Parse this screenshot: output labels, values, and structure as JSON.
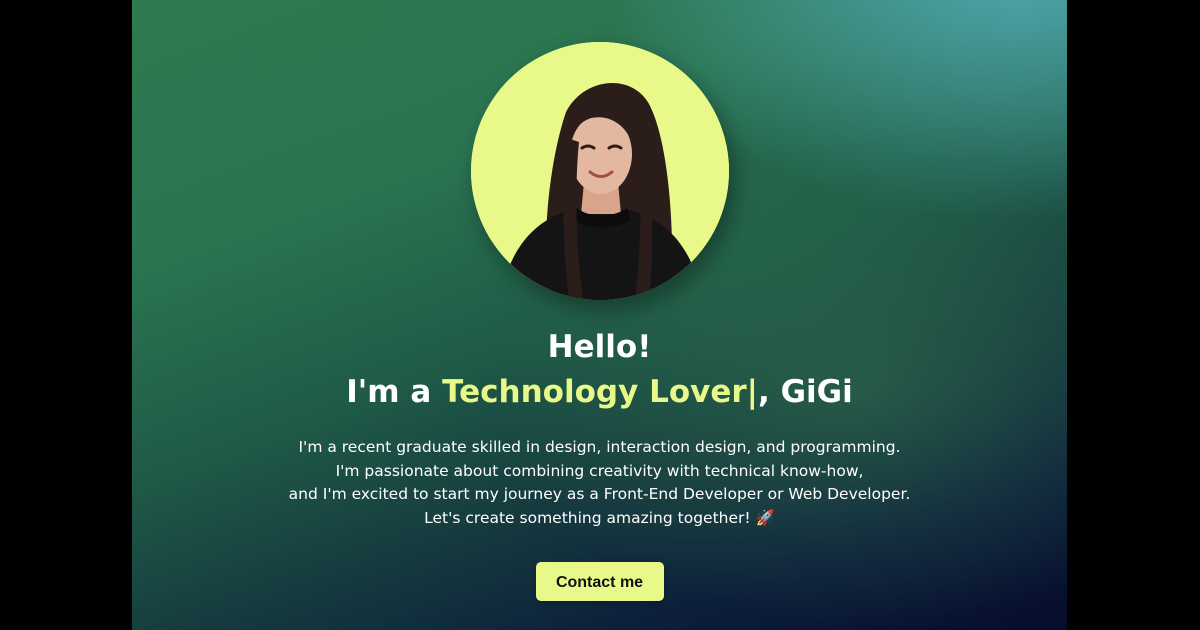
{
  "hero": {
    "greeting": "Hello!",
    "headline_prefix": "I'm a ",
    "headline_role": "Technology Lover",
    "headline_cursor": "|",
    "headline_suffix": ", GiGi",
    "bio_lines": [
      "I'm a recent graduate skilled in design, interaction design, and programming.",
      "I'm passionate about combining creativity with technical know-how,",
      "and I'm excited to start my journey as a Front-End Developer or Web Developer.",
      "Let's create something amazing together! 🚀"
    ],
    "contact_button_label": "Contact me"
  },
  "colors": {
    "accent": "#e8f98a",
    "letterbox": "#000000",
    "text": "#ffffff"
  },
  "avatar": {
    "icon": "profile-photo"
  }
}
